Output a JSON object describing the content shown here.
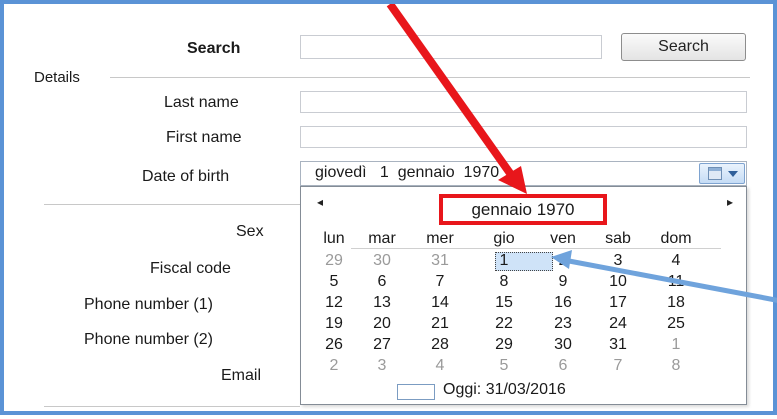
{
  "form": {
    "search_label": "Search",
    "search_value": "",
    "search_button": "Search",
    "details_group": "Details",
    "last_name_label": "Last name",
    "first_name_label": "First name",
    "dob_label": "Date of birth",
    "dob_value": "giovedì   1  gennaio  1970",
    "sex_label": "Sex",
    "fiscal_code_label": "Fiscal code",
    "phone1_label": "Phone number (1)",
    "phone2_label": "Phone number (2)",
    "email_label": "Email"
  },
  "calendar": {
    "month_title": "gennaio 1970",
    "prev_label": "◂",
    "next_label": "▸",
    "weekdays": [
      "lun",
      "mar",
      "mer",
      "gio",
      "ven",
      "sab",
      "dom"
    ],
    "weeks": [
      [
        "29",
        "30",
        "31",
        "1",
        "2",
        "3",
        "4"
      ],
      [
        "5",
        "6",
        "7",
        "8",
        "9",
        "10",
        "11"
      ],
      [
        "12",
        "13",
        "14",
        "15",
        "16",
        "17",
        "18"
      ],
      [
        "19",
        "20",
        "21",
        "22",
        "23",
        "24",
        "25"
      ],
      [
        "26",
        "27",
        "28",
        "29",
        "30",
        "31",
        "1"
      ],
      [
        "2",
        "3",
        "4",
        "5",
        "6",
        "7",
        "8"
      ]
    ],
    "today_label": "Oggi: 31/03/2016"
  },
  "colors": {
    "frame": "#5b93d6",
    "highlight_box": "#e8161b",
    "red_arrow": "#e8161b",
    "blue_arrow": "#6fa3dc",
    "selected_day_bg": "#cfe3f8"
  },
  "icons": {
    "dropdown_button": "calendar-icon",
    "dropdown_arrow": "chevron-down-icon"
  }
}
